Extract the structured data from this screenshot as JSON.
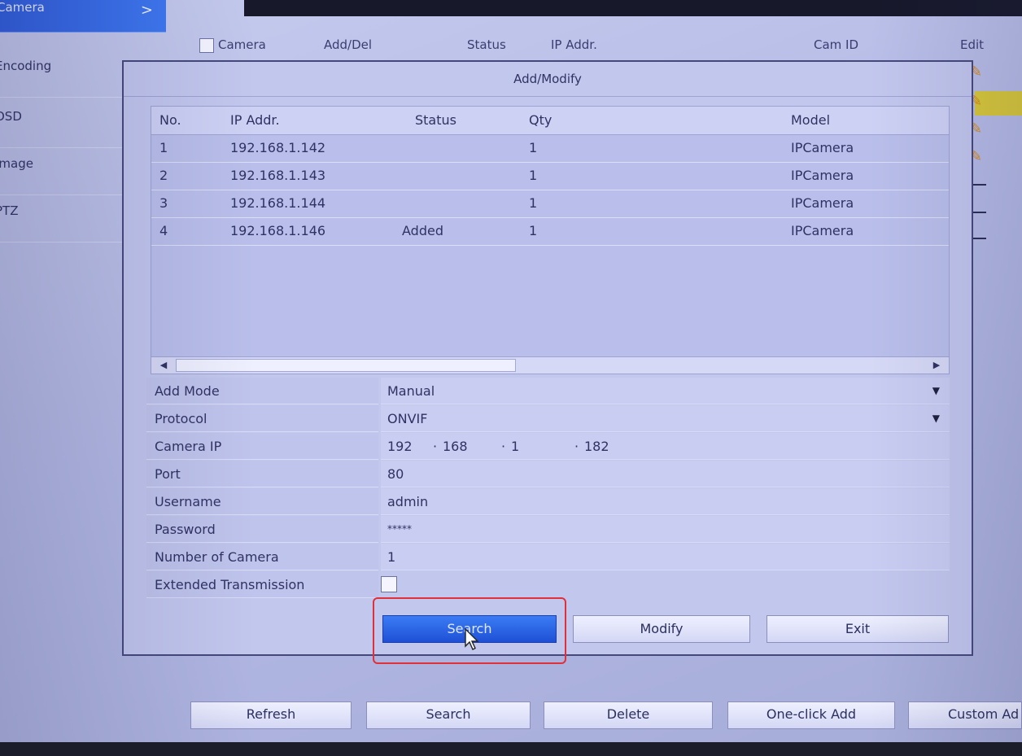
{
  "sidebar": {
    "items": [
      {
        "label": "Camera",
        "active": true
      },
      {
        "label": "Encoding"
      },
      {
        "label": "OSD"
      },
      {
        "label": "Image"
      },
      {
        "label": "PTZ"
      }
    ]
  },
  "background_table": {
    "columns": [
      "Camera",
      "Add/Del",
      "Status",
      "IP Addr.",
      "Cam ID",
      "Edit"
    ]
  },
  "bottom_buttons": [
    "Refresh",
    "Search",
    "Delete",
    "One-click Add",
    "Custom Ad"
  ],
  "dialog": {
    "title": "Add/Modify",
    "grid": {
      "columns": [
        "No.",
        "IP Addr.",
        "Status",
        "Qty",
        "Model"
      ],
      "rows": [
        {
          "no": "1",
          "ip": "192.168.1.142",
          "status": "",
          "qty": "1",
          "model": "IPCamera"
        },
        {
          "no": "2",
          "ip": "192.168.1.143",
          "status": "",
          "qty": "1",
          "model": "IPCamera"
        },
        {
          "no": "3",
          "ip": "192.168.1.144",
          "status": "",
          "qty": "1",
          "model": "IPCamera"
        },
        {
          "no": "4",
          "ip": "192.168.1.146",
          "status": "Added",
          "qty": "1",
          "model": "IPCamera"
        }
      ]
    },
    "form": {
      "add_mode": {
        "label": "Add Mode",
        "value": "Manual"
      },
      "protocol": {
        "label": "Protocol",
        "value": "ONVIF"
      },
      "camera_ip": {
        "label": "Camera IP",
        "octets": [
          "192",
          "168",
          "1",
          "182"
        ]
      },
      "port": {
        "label": "Port",
        "value": "80"
      },
      "username": {
        "label": "Username",
        "value": "admin"
      },
      "password": {
        "label": "Password",
        "value": "*****"
      },
      "number_of_camera": {
        "label": "Number of Camera",
        "value": "1"
      },
      "extended_transmission": {
        "label": "Extended Transmission",
        "checked": false
      }
    },
    "buttons": {
      "search": "Search",
      "modify": "Modify",
      "exit": "Exit"
    }
  },
  "colors": {
    "highlight_box": "#e0303a",
    "primary_button": "#2a62e6",
    "sidebar_active": "#3569ea"
  }
}
